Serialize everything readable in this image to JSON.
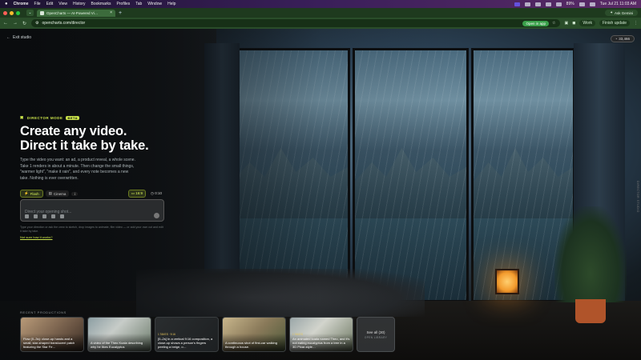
{
  "menubar": {
    "apple": "",
    "app": "Chrome",
    "items": [
      "File",
      "Edit",
      "View",
      "History",
      "Bookmarks",
      "Profiles",
      "Tab",
      "Window",
      "Help"
    ],
    "status_text": "89%",
    "clock": "Tue Jul 21  11:03 AM"
  },
  "browser": {
    "tab_title": "OpenCharts — AI-Powered Vi…",
    "new_tab": "+",
    "ask_gemini": "Ask Gemini",
    "url": "opencharts.com/director",
    "open_in_app": "Open in app",
    "work_profile": "Work",
    "finish_update": "Finish update"
  },
  "page": {
    "exit_label": "Exit studio",
    "credits": "33,466",
    "mode_badge": "DIRECTOR MODE",
    "beta": "BETA",
    "headline_line1": "Create any video.",
    "headline_line2": "Direct it take by take.",
    "description": "Type the video you want: an ad, a product reveal, a whole scene. Take 1 renders in about a minute. Then change the small things, \"warmer light\", \"make it rain\", and every note becomes a new take. Nothing is ever overwritten.",
    "modes": {
      "flash": "Flash",
      "cinema": "Cinema",
      "info": "i",
      "ratio": "16:9",
      "duration": "0:10"
    },
    "input_placeholder": "Direct your opening shot...",
    "hint": "Type your direction or ask the crew to sketch, drop images to animate, film video — or add your own cut and edit it take by take.",
    "see_how": "Not sure how it works?",
    "recent_label": "RECENT PRODUCTIONS",
    "cards": [
      {
        "meta": "",
        "caption": "Flow (0–3s): close-up hands and a small, star-shaped translucent patch featuring the Star Fe…"
      },
      {
        "meta": "",
        "caption": "A video of the Theo Koala describing why he likes Eucalyptus"
      },
      {
        "meta": "1 TAKES · 9:16",
        "caption": "[0–2s] In a vertical 9:16 composition, a close-up shows a person's fingers peeling a beige, o…"
      },
      {
        "meta": "",
        "caption": "A continuous shot of first-car walking through a house."
      },
      {
        "meta": "1 TAKES",
        "caption": "An animated koala named Theo, and it's not eating eucalyptus from a tree in a 3D Pixar-style…"
      }
    ],
    "see_all": "See all (30)",
    "see_all_sub": "OPEN LIBRARY",
    "side_label": "DIRECTOR STUDIO"
  },
  "colors": {
    "accent": "#c9e24a",
    "tab_green": "#3c6b3c",
    "open_app_green": "#3aa04a"
  }
}
